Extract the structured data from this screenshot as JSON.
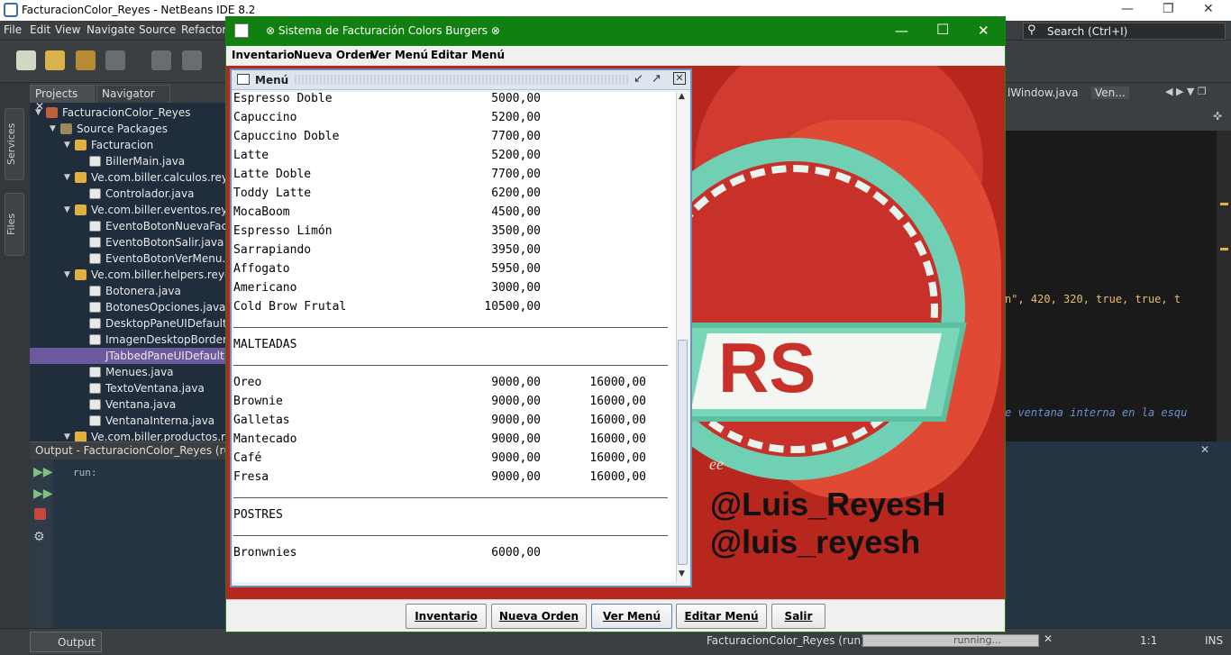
{
  "ide": {
    "title": "FacturacionColor_Reyes - NetBeans IDE 8.2",
    "menu": [
      "File",
      "Edit",
      "View",
      "Navigate",
      "Source",
      "Refactor"
    ],
    "search_placeholder": "Search (Ctrl+I)",
    "side_tabs": [
      "Services",
      "Files"
    ],
    "panel_tabs": [
      "Projects",
      "Navigator"
    ],
    "tree": [
      {
        "label": "FacturacionColor_Reyes",
        "level": 0
      },
      {
        "label": "Source Packages",
        "level": 1
      },
      {
        "label": "Facturacion",
        "level": 2
      },
      {
        "label": "BillerMain.java",
        "level": 3
      },
      {
        "label": "Ve.com.biller.calculos.reye",
        "level": 2
      },
      {
        "label": "Controlador.java",
        "level": 3
      },
      {
        "label": "Ve.com.biller.eventos.reye",
        "level": 2
      },
      {
        "label": "EventoBotonNuevaFact",
        "level": 3
      },
      {
        "label": "EventoBotonSalir.java",
        "level": 3
      },
      {
        "label": "EventoBotonVerMenu.ja",
        "level": 3
      },
      {
        "label": "Ve.com.biller.helpers.reyes",
        "level": 2
      },
      {
        "label": "Botonera.java",
        "level": 3
      },
      {
        "label": "BotonesOpciones.java",
        "level": 3
      },
      {
        "label": "DesktopPaneUIDefault.",
        "level": 3
      },
      {
        "label": "ImagenDesktopBorder.",
        "level": 3
      },
      {
        "label": "JTabbedPaneUIDefault",
        "level": 3
      },
      {
        "label": "Menues.java",
        "level": 3
      },
      {
        "label": "TextoVentana.java",
        "level": 3
      },
      {
        "label": "Ventana.java",
        "level": 3
      },
      {
        "label": "VentanaInterna.java",
        "level": 3
      },
      {
        "label": "Ve.com.biller.productos.re",
        "level": 2
      }
    ],
    "output_title": "Output - FacturacionColor_Reyes (run",
    "output_text": "run:",
    "editor_tabs": [
      "lWindow.java",
      "Ven..."
    ],
    "code_line_1": "n\", 420, 320, true, true, t",
    "code_line_2": "e ventana interna en la esqu",
    "status": {
      "project": "FacturacionColor_Reyes (run)",
      "progress": "running...",
      "position": "1:1",
      "mode": "INS",
      "output_button": "Output"
    }
  },
  "app": {
    "title": "⊗ Sistema de Facturación Colors Burgers ⊗",
    "menu": [
      "Inventario",
      "Nueva Orden",
      "Ver Menú",
      "Editar Menú"
    ],
    "buttons": [
      "Inventario",
      "Nueva Orden",
      "Ver Menú",
      "Editar Menú",
      "Salir"
    ],
    "social": [
      "@Luis_ReyesH",
      "@luis_reyesh"
    ],
    "logo_text": "RS",
    "logo_sub": "ee",
    "internal_frame": {
      "title": "Menú",
      "items_top": [
        {
          "name": "Espresso Doble",
          "price": "5000,00"
        },
        {
          "name": "Capuccino",
          "price": "5200,00"
        },
        {
          "name": "Capuccino Doble",
          "price": "7700,00"
        },
        {
          "name": "Latte",
          "price": "5200,00"
        },
        {
          "name": "Latte Doble",
          "price": "7700,00"
        },
        {
          "name": "Toddy Latte",
          "price": "6200,00"
        },
        {
          "name": "MocaBoom",
          "price": "4500,00"
        },
        {
          "name": "Espresso Limón",
          "price": "3500,00"
        },
        {
          "name": "Sarrapiando",
          "price": "3950,00"
        },
        {
          "name": "Affogato",
          "price": "5950,00"
        },
        {
          "name": "Americano",
          "price": "3000,00"
        },
        {
          "name": "Cold Brow Frutal",
          "price": "10500,00"
        }
      ],
      "section_malteadas": "MALTEADAS",
      "malteadas": [
        {
          "name": "Oreo",
          "price": "9000,00",
          "price2": "16000,00"
        },
        {
          "name": "Brownie",
          "price": "9000,00",
          "price2": "16000,00"
        },
        {
          "name": "Galletas",
          "price": "9000,00",
          "price2": "16000,00"
        },
        {
          "name": "Mantecado",
          "price": "9000,00",
          "price2": "16000,00"
        },
        {
          "name": "Café",
          "price": "9000,00",
          "price2": "16000,00"
        },
        {
          "name": "Fresa",
          "price": "9000,00",
          "price2": "16000,00"
        }
      ],
      "section_postres": "POSTRES",
      "postres": [
        {
          "name": "Bronwnies",
          "price": "6000,00"
        }
      ]
    }
  }
}
